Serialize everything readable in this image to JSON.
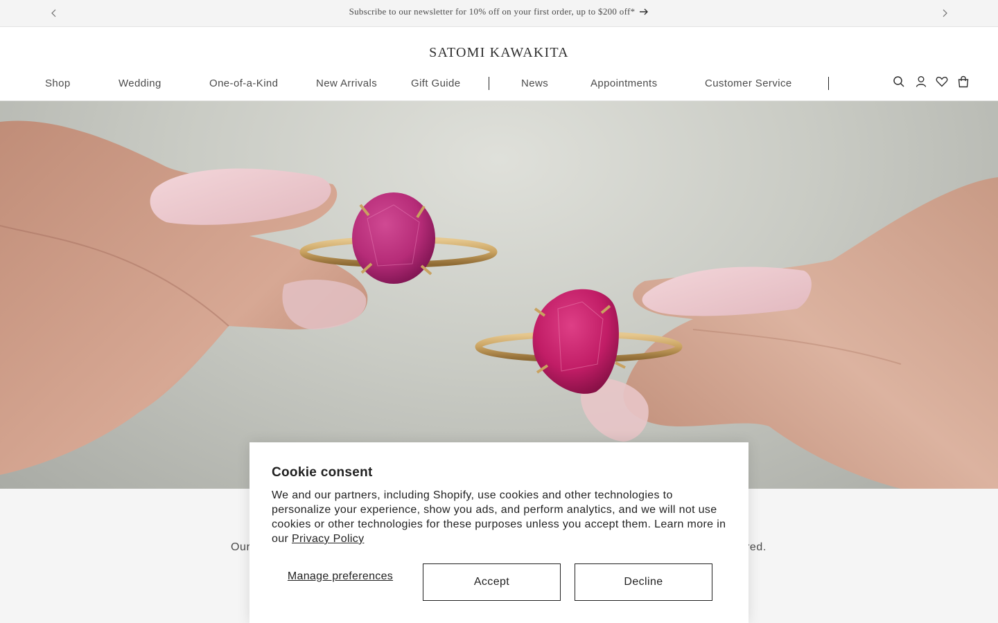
{
  "announcement": {
    "text": "Subscribe to our newsletter for 10% off on your first order, up to $200 off*",
    "prev_icon": "chevron-left-icon",
    "next_icon": "chevron-right-icon",
    "arrow_icon": "arrow-right-icon"
  },
  "header": {
    "logo": "SATOMI KAWAKITA",
    "nav": [
      "Shop",
      "Wedding",
      "One-of-a-Kind",
      "New Arrivals",
      "Gift Guide",
      "News",
      "Appointments",
      "Customer Service"
    ],
    "icons": [
      "search-icon",
      "account-icon",
      "wishlist-heart-icon",
      "cart-bag-icon"
    ]
  },
  "hero": {
    "image": "Two hands holding gold rings with pink ruby stones"
  },
  "below": {
    "text_left": "Our",
    "text_right": "red."
  },
  "cookie": {
    "title": "Cookie consent",
    "body": "We and our partners, including Shopify, use cookies and other technologies to personalize your experience, show you ads, and perform analytics, and we will not use cookies or other technologies for these purposes unless you accept them. Learn more in our ",
    "privacy_link": "Privacy Policy",
    "manage_label": "Manage preferences",
    "accept_label": "Accept",
    "decline_label": "Decline"
  }
}
